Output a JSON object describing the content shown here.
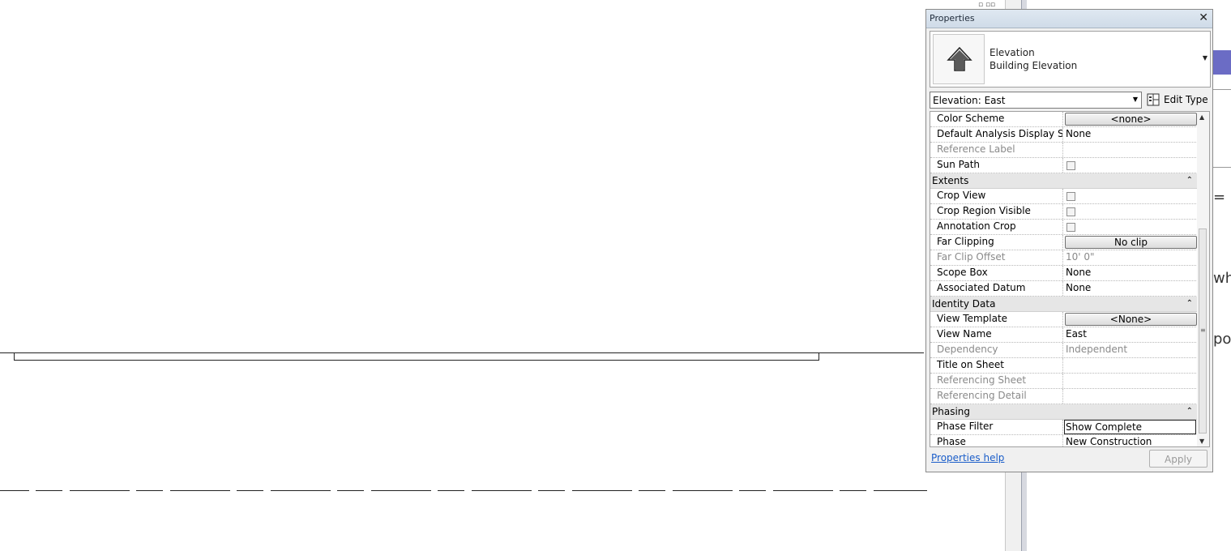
{
  "palette": {
    "title": "Properties",
    "close_glyph": "✕",
    "type_selector": {
      "family": "Elevation",
      "type": "Building Elevation",
      "icon": "elevation-arrow-icon"
    },
    "instance_filter": "Elevation: East",
    "edit_type_label": "Edit Type",
    "rows": [
      {
        "kind": "prop",
        "label": "Color Scheme",
        "value": "<none>",
        "control": "button"
      },
      {
        "kind": "prop",
        "label": "Default Analysis Display Style",
        "value": "None"
      },
      {
        "kind": "prop",
        "label": "Reference Label",
        "value": "",
        "disabled": true
      },
      {
        "kind": "prop",
        "label": "Sun Path",
        "value": "",
        "control": "checkbox"
      },
      {
        "kind": "group",
        "label": "Extents",
        "collapse_glyph": "⌃"
      },
      {
        "kind": "prop",
        "label": "Crop View",
        "value": "",
        "control": "checkbox"
      },
      {
        "kind": "prop",
        "label": "Crop Region Visible",
        "value": "",
        "control": "checkbox"
      },
      {
        "kind": "prop",
        "label": "Annotation Crop",
        "value": "",
        "control": "checkbox"
      },
      {
        "kind": "prop",
        "label": "Far Clipping",
        "value": "No clip",
        "control": "button"
      },
      {
        "kind": "prop",
        "label": "Far Clip Offset",
        "value": "10'  0\"",
        "disabled": true
      },
      {
        "kind": "prop",
        "label": "Scope Box",
        "value": "None"
      },
      {
        "kind": "prop",
        "label": "Associated Datum",
        "value": "None"
      },
      {
        "kind": "group",
        "label": "Identity Data",
        "collapse_glyph": "⌃"
      },
      {
        "kind": "prop",
        "label": "View Template",
        "value": "<None>",
        "control": "button"
      },
      {
        "kind": "prop",
        "label": "View Name",
        "value": "East"
      },
      {
        "kind": "prop",
        "label": "Dependency",
        "value": "Independent",
        "disabled": true
      },
      {
        "kind": "prop",
        "label": "Title on Sheet",
        "value": ""
      },
      {
        "kind": "prop",
        "label": "Referencing Sheet",
        "value": "",
        "disabled": true
      },
      {
        "kind": "prop",
        "label": "Referencing Detail",
        "value": "",
        "disabled": true
      },
      {
        "kind": "group",
        "label": "Phasing",
        "collapse_glyph": "⌃"
      },
      {
        "kind": "prop",
        "label": "Phase Filter",
        "value": "Show Complete",
        "control": "select"
      },
      {
        "kind": "prop",
        "label": "Phase",
        "value": "New Construction"
      }
    ],
    "help_link": "Properties help",
    "apply_label": "Apply"
  },
  "doc_fragments": {
    "line1": "= r",
    "line2": "whe",
    "line3": "pos"
  },
  "colors": {
    "accent_purple": "#6b6cc5",
    "link_blue": "#1a5dc9"
  }
}
